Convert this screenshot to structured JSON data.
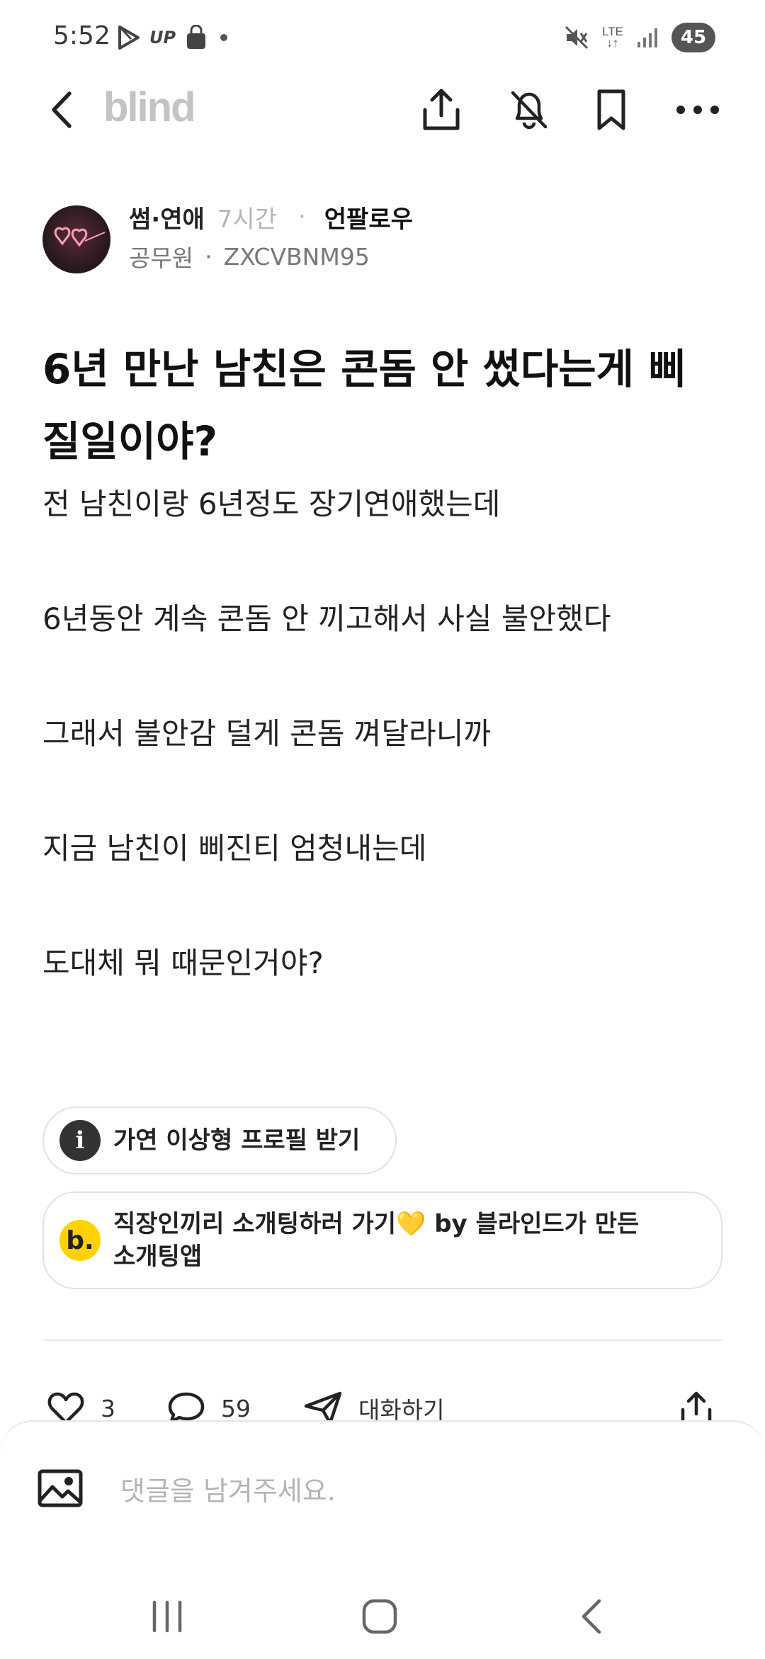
{
  "status_bar": {
    "time": "5:52",
    "up_label": "UP",
    "network_type": "LTE",
    "battery_level": "45"
  },
  "app_bar": {
    "brand": "blind"
  },
  "author": {
    "category": "썸·연애",
    "time": "7시간",
    "separator_dot": "·",
    "follow_label": "언팔로우",
    "company": "공무원",
    "separator": "·",
    "nickname": "ZXCVBNM95"
  },
  "post": {
    "title": "6년 만난 남친은 콘돔 안 썼다는게 삐질일이야?",
    "lines": [
      "전 남친이랑 6년정도 장기연애했는데",
      "6년동안 계속 콘돔 안 끼고해서 사실 불안했다",
      "그래서 불안감 덜게 콘돔 껴달라니까",
      "지금 남친이 삐진티 엄청내는데",
      "도대체 뭐 때문인거야?"
    ]
  },
  "promos": {
    "info_icon": "i",
    "info_label": "가연 이상형 프로필 받기",
    "blind_icon": "b.",
    "blind_label_line1": "직장인끼리 소개팅하러 가기💛 by 블라인드가 만든",
    "blind_label_line2": "소개팅앱"
  },
  "actions": {
    "like_count": "3",
    "comment_count": "59",
    "chat_label": "대화하기"
  },
  "composer": {
    "placeholder": "댓글을 남겨주세요."
  },
  "icons": {
    "back": "chevron-left-icon",
    "share": "share-icon",
    "notifications_off": "bell-off-icon",
    "bookmark": "bookmark-icon",
    "more": "more-dots-icon",
    "like": "heart-icon",
    "comment": "comment-bubble-icon",
    "chat": "send-icon",
    "image": "image-icon"
  },
  "colors": {
    "brand_gray": "#c3c3c3",
    "promo_yellow": "#ffd200",
    "text_primary": "#111111",
    "text_muted": "#777777"
  }
}
